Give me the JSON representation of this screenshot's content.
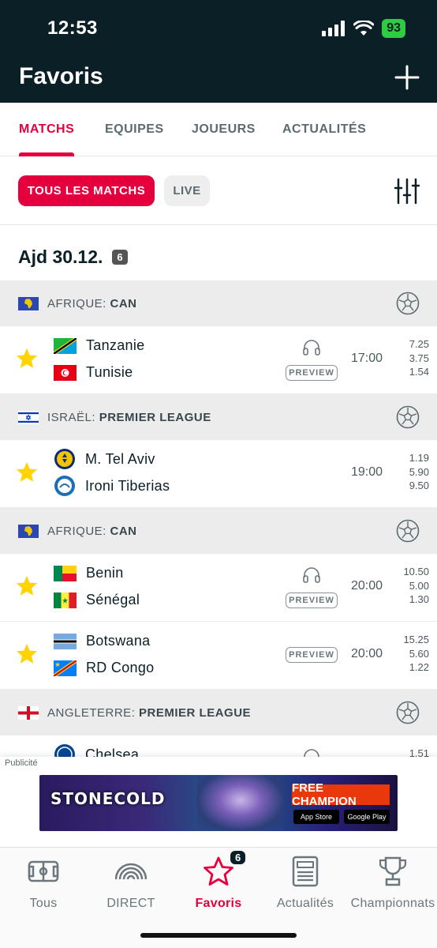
{
  "status_bar": {
    "time": "12:53",
    "battery": "93"
  },
  "header": {
    "title": "Favoris"
  },
  "tabs": [
    {
      "label": "MATCHS",
      "active": true
    },
    {
      "label": "EQUIPES",
      "active": false
    },
    {
      "label": "JOUEURS",
      "active": false
    },
    {
      "label": "ACTUALITÉS",
      "active": false
    }
  ],
  "filters": {
    "all_label": "TOUS LES MATCHS",
    "live_label": "LIVE"
  },
  "date": {
    "label": "Ajd 30.12.",
    "count": "6"
  },
  "leagues": [
    {
      "country": "AFRIQUE:",
      "name": "CAN"
    },
    {
      "country": "ISRAËL:",
      "name": "PREMIER LEAGUE"
    },
    {
      "country": "AFRIQUE:",
      "name": "CAN"
    },
    {
      "country": "ANGLETERRE:",
      "name": "PREMIER LEAGUE"
    }
  ],
  "matches": [
    {
      "home": "Tanzanie",
      "away": "Tunisie",
      "time": "17:00",
      "odds": [
        "7.25",
        "3.75",
        "1.54"
      ],
      "preview": "PREVIEW"
    },
    {
      "home": "M. Tel Aviv",
      "away": "Ironi Tiberias",
      "time": "19:00",
      "odds": [
        "1.19",
        "5.90",
        "9.50"
      ]
    },
    {
      "home": "Benin",
      "away": "Sénégal",
      "time": "20:00",
      "odds": [
        "10.50",
        "5.00",
        "1.30"
      ],
      "preview": "PREVIEW"
    },
    {
      "home": "Botswana",
      "away": "RD Congo",
      "time": "20:00",
      "odds": [
        "15.25",
        "5.60",
        "1.22"
      ],
      "preview": "PREVIEW"
    },
    {
      "home": "Chelsea",
      "odds": [
        "1.51"
      ]
    }
  ],
  "ad": {
    "label": "Publicité",
    "brand": "STONECOLD",
    "cta": "FREE CHAMPION",
    "app_store": "App Store",
    "google_play": "Google Play"
  },
  "bottom_nav": [
    {
      "label": "Tous",
      "icon": "pitch-icon"
    },
    {
      "label": "DIRECT",
      "icon": "broadcast-icon"
    },
    {
      "label": "Favoris",
      "icon": "star-icon",
      "badge": "6",
      "active": true
    },
    {
      "label": "Actualités",
      "icon": "news-icon"
    },
    {
      "label": "Championnats",
      "icon": "trophy-icon"
    }
  ],
  "colors": {
    "accent": "#e5003d",
    "header_bg": "#0b1f26",
    "star": "#ffd400"
  }
}
